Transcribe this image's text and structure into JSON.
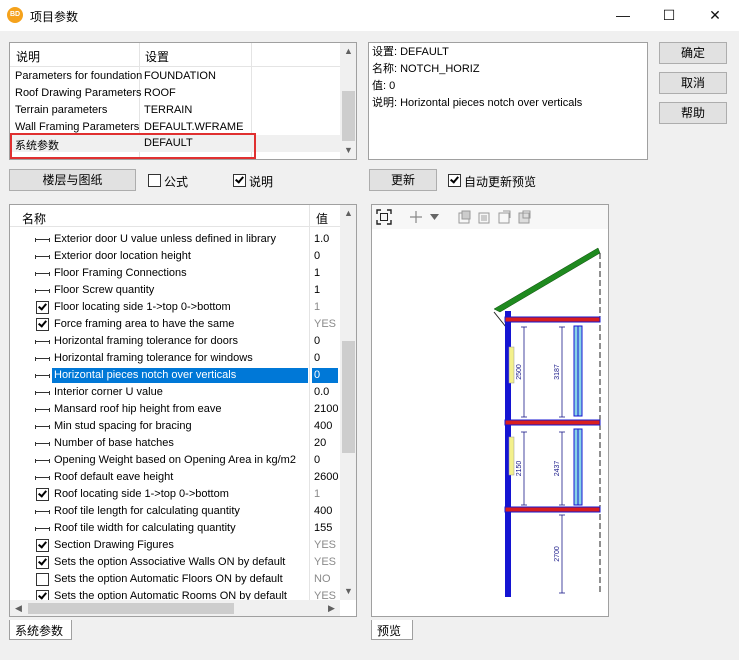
{
  "window": {
    "app_icon_text": "BD",
    "title": "项目参数",
    "minimize": "—",
    "maximize": "☐",
    "close": "✕"
  },
  "top_grid": {
    "headers": [
      "说明",
      "设置"
    ],
    "rows": [
      {
        "name": "Parameters for foundation",
        "value": "FOUNDATION"
      },
      {
        "name": "Roof Drawing Parameters",
        "value": "ROOF"
      },
      {
        "name": "Terrain parameters",
        "value": "TERRAIN"
      },
      {
        "name": "Wall Framing Parameters",
        "value": "DEFAULT.WFRAME"
      },
      {
        "name": "系统参数",
        "value": "DEFAULT"
      }
    ]
  },
  "info": {
    "setting": "设置: DEFAULT",
    "name": "名称: NOTCH_HORIZ",
    "value": "值: 0",
    "description": "说明: Horizontal pieces notch over verticals"
  },
  "buttons": {
    "ok": "确定",
    "cancel": "取消",
    "help": "帮助",
    "floors": "楼层与图纸",
    "update": "更新"
  },
  "options": {
    "formula": {
      "label": "公式",
      "checked": false
    },
    "description": {
      "label": "说明",
      "checked": true
    },
    "auto_update": {
      "label": "自动更新预览",
      "checked": true
    }
  },
  "param_list": {
    "headers": [
      "名称",
      "值"
    ],
    "rows": [
      {
        "icon": "dimension",
        "name": "Exterior door U value unless defined in library",
        "value": "1.0",
        "grey": false
      },
      {
        "icon": "dimension",
        "name": "Exterior door location height",
        "value": "0",
        "grey": false
      },
      {
        "icon": "dimension",
        "name": "Floor Framing Connections",
        "value": "1",
        "grey": false
      },
      {
        "icon": "dimension",
        "name": "Floor Screw quantity",
        "value": "1",
        "grey": false
      },
      {
        "icon": "checkbox",
        "checked": true,
        "name": "Floor locating side 1->top 0->bottom",
        "value": "1",
        "grey": true
      },
      {
        "icon": "checkbox",
        "checked": true,
        "name": "Force framing area to have the same",
        "value": "YES",
        "grey": true
      },
      {
        "icon": "dimension",
        "name": "Horizontal framing tolerance for doors",
        "value": "0",
        "grey": false
      },
      {
        "icon": "dimension",
        "name": "Horizontal framing tolerance for windows",
        "value": "0",
        "grey": false
      },
      {
        "icon": "dimension",
        "name": "Horizontal pieces notch over verticals",
        "value": "0",
        "grey": false,
        "selected": true
      },
      {
        "icon": "dimension",
        "name": "Interior corner U value",
        "value": "0.0",
        "grey": false
      },
      {
        "icon": "dimension",
        "name": "Mansard roof hip height from eave",
        "value": "2100",
        "grey": false
      },
      {
        "icon": "dimension",
        "name": "Min stud spacing for bracing",
        "value": "400",
        "grey": false
      },
      {
        "icon": "dimension",
        "name": "Number of base hatches",
        "value": "20",
        "grey": false
      },
      {
        "icon": "dimension",
        "name": "Opening Weight based on Opening Area in kg/m2",
        "value": "0",
        "grey": false
      },
      {
        "icon": "dimension",
        "name": "Roof default eave height",
        "value": "2600",
        "grey": false
      },
      {
        "icon": "checkbox",
        "checked": true,
        "name": "Roof locating side 1->top 0->bottom",
        "value": "1",
        "grey": true
      },
      {
        "icon": "dimension",
        "name": "Roof tile length for calculating quantity",
        "value": "400",
        "grey": false
      },
      {
        "icon": "dimension",
        "name": "Roof tile width for calculating quantity",
        "value": "155",
        "grey": false
      },
      {
        "icon": "checkbox",
        "checked": true,
        "name": "Section Drawing Figures",
        "value": "YES",
        "grey": true
      },
      {
        "icon": "checkbox",
        "checked": true,
        "name": "Sets the option Associative Walls ON by default",
        "value": "YES",
        "grey": true
      },
      {
        "icon": "checkbox",
        "checked": false,
        "name": "Sets the option Automatic Floors ON by default",
        "value": "NO",
        "grey": true
      },
      {
        "icon": "checkbox",
        "checked": true,
        "name": "Sets the option Automatic Rooms ON by default",
        "value": "YES",
        "grey": true
      }
    ]
  },
  "preview": {
    "dimension_labels": [
      "2500",
      "3187",
      "2150",
      "2437",
      "2700"
    ],
    "colors": {
      "wall": "#1414d2",
      "floor": "#d81e1e",
      "roof": "#1f8a1f",
      "stud": "#88d3e6",
      "window": "#f3f08c",
      "dim": "#1a1a8a"
    }
  },
  "tabs": {
    "left": "系统参数",
    "right": "预览"
  }
}
